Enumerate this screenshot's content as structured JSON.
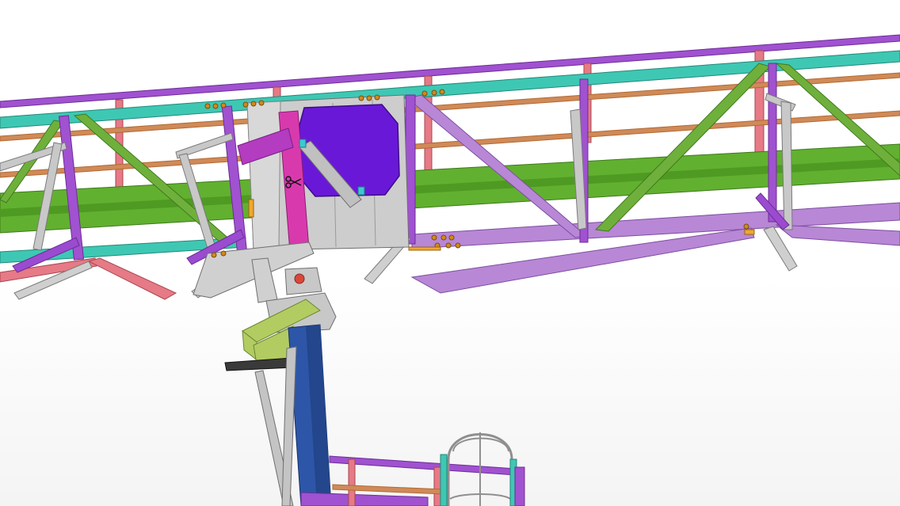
{
  "scene": {
    "description_kind": "3d-structural-model-viewport",
    "colors": {
      "handrail_top": "#9b3fc7",
      "handrail_mid": "#c9854a",
      "handrail_post": "#e0707a",
      "stringer_teal": "#3ec8b4",
      "walkway_green": "#5aa82a",
      "diagonal_green": "#6aa83a",
      "diagonal_lilac": "#b07ad0",
      "gusset_grey": "#c8c8c8",
      "plate_purple": "#6a18d8",
      "column_blue": "#2a4fa0",
      "seat_yellowgreen": "#a8c85a",
      "bracket_magenta": "#d23ab0",
      "bolt_orange": "#d08a20",
      "ladder_grey": "#9a9a9a"
    }
  },
  "cursor": {
    "icon": "scissors-cursor-icon"
  }
}
